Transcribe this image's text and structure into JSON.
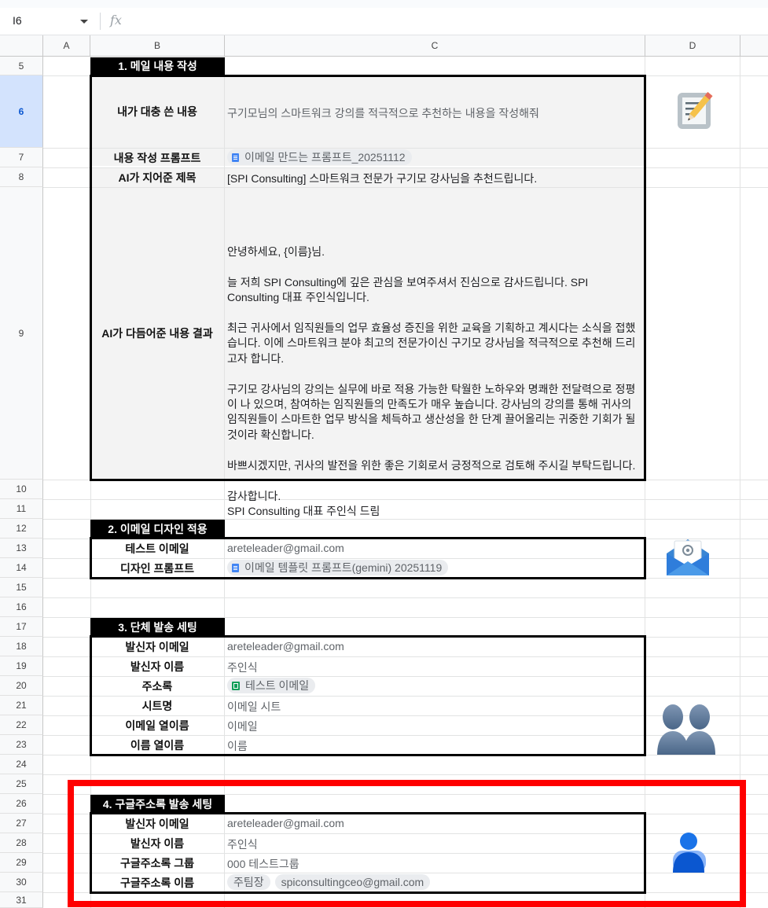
{
  "formula_bar": {
    "name_box": "I6",
    "fx": "fx"
  },
  "columns": [
    "A",
    "B",
    "C",
    "D"
  ],
  "rows": [
    "5",
    "6",
    "7",
    "8",
    "9",
    "10",
    "11",
    "12",
    "13",
    "14",
    "15",
    "16",
    "17",
    "18",
    "19",
    "20",
    "21",
    "22",
    "23",
    "24",
    "25",
    "26",
    "27",
    "28",
    "29",
    "30",
    "31"
  ],
  "section1": {
    "heading": "1. 메일 내용 작성",
    "draft_label": "내가 대충 쓴 내용",
    "draft_value": "구기모님의 스마트워크 강의를 적극적으로 추천하는 내용을 작성해줘",
    "prompt_label": "내용 작성 프롬프트",
    "prompt_chip": "이메일 만드는 프롬프트_20251112",
    "subject_label": "AI가 지어준 제목",
    "subject_value": "[SPI Consulting] 스마트워크 전문가 구기모 강사님을 추천드립니다.",
    "result_label": "AI가 다듬어준 내용 결과",
    "letter": [
      "안녕하세요, {이름}님.",
      "",
      "늘 저희 SPI Consulting에 깊은 관심을 보여주셔서 진심으로 감사드립니다. SPI Consulting 대표 주인식입니다.",
      "",
      "최근 귀사에서 임직원들의 업무 효율성 증진을 위한 교육을 기획하고 계시다는 소식을 접했습니다. 이에 스마트워크 분야 최고의 전문가이신 구기모 강사님을 적극적으로 추천해 드리고자 합니다.",
      "",
      "구기모 강사님의 강의는 실무에 바로 적용 가능한 탁월한 노하우와 명쾌한 전달력으로 정평이 나 있으며, 참여하는 임직원들의 만족도가 매우 높습니다. 강사님의 강의를 통해 귀사의 임직원들이 스마트한 업무 방식을 체득하고 생산성을 한 단계 끌어올리는 귀중한 기회가 될 것이라 확신합니다.",
      "",
      "바쁘시겠지만, 귀사의 발전을 위한 좋은 기회로서 긍정적으로 검토해 주시길 부탁드립니다.",
      "",
      "감사합니다.",
      "SPI Consulting 대표 주인식 드림"
    ]
  },
  "section2": {
    "heading": "2. 이메일 디자인 적용",
    "test_label": "테스트 이메일",
    "test_value": "areteleader@gmail.com",
    "design_label": "디자인 프롬프트",
    "design_chip": "이메일 템플릿 프롬프트(gemini) 20251119"
  },
  "section3": {
    "heading": "3. 단체 발송 세팅",
    "sender_email_label": "발신자 이메일",
    "sender_email_value": "areteleader@gmail.com",
    "sender_name_label": "발신자 이름",
    "sender_name_value": "주인식",
    "addressbook_label": "주소록",
    "addressbook_chip": "테스트 이메일",
    "sheet_label": "시트명",
    "sheet_value": "이메일 시트",
    "email_col_label": "이메일 열이름",
    "email_col_value": "이메일",
    "name_col_label": "이름 열이름",
    "name_col_value": "이름"
  },
  "section4": {
    "heading": "4. 구글주소록 발송 세팅",
    "sender_email_label": "발신자 이메일",
    "sender_email_value": "areteleader@gmail.com",
    "sender_name_label": "발신자 이름",
    "sender_name_value": "주인식",
    "group_label": "구글주소록 그룹",
    "group_value": "000 테스트그룹",
    "contact_label": "구글주소록 이름",
    "contact_chip_1": "주팀장",
    "contact_chip_2": "spiconsultingceo@gmail.com"
  },
  "icons": [
    "memo-icon",
    "envelope-icon",
    "people-icon",
    "contact-icon"
  ],
  "colors": {
    "highlight_box": "#ff0000",
    "selected_row": "#d3e3fd",
    "doc_chip": "#4285f4",
    "sheet_chip": "#0f9d58"
  }
}
